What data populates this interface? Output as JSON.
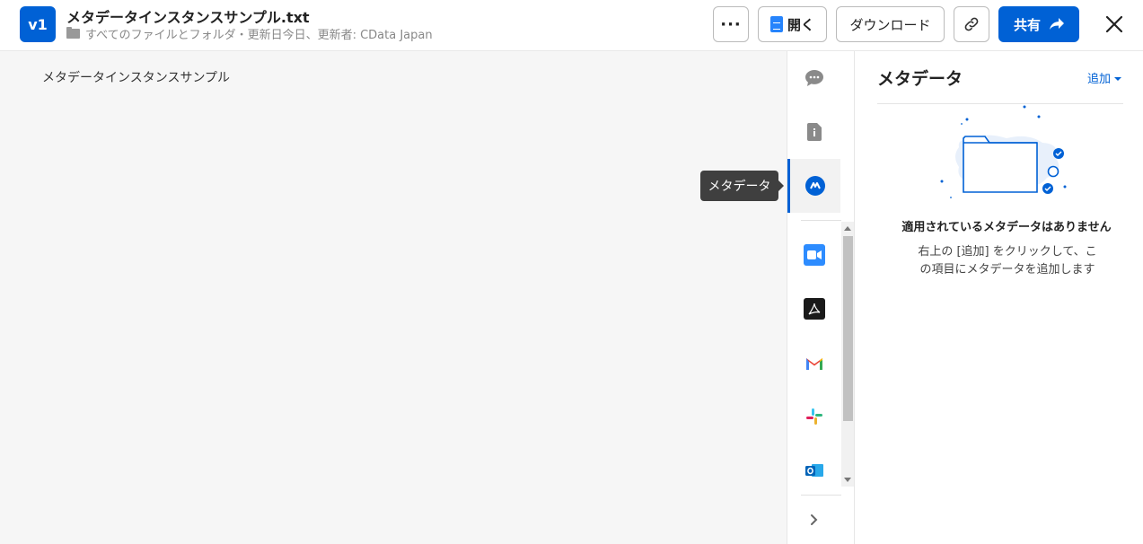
{
  "header": {
    "version": "v1",
    "file_title": "メタデータインスタンスサンプル.txt",
    "file_path": "すべてのファイルとフォルダ・更新日今日、更新者: CData Japan",
    "more_label": "···",
    "open_label": "開く",
    "download_label": "ダウンロード",
    "share_label": "共有"
  },
  "preview": {
    "content": "メタデータインスタンスサンプル"
  },
  "sidenav": {
    "tooltip": "メタデータ",
    "active": "metadata",
    "apps": [
      "zoom-icon",
      "adobe-acrobat-icon",
      "gmail-icon",
      "slack-icon",
      "outlook-icon"
    ]
  },
  "panel": {
    "title": "メタデータ",
    "add_label": "追加",
    "empty_title": "適用されているメタデータはありません",
    "empty_desc": "右上の [追加] をクリックして、この項目にメタデータを追加します"
  },
  "colors": {
    "accent": "#0061d5",
    "preview_bg": "#f6f6f6"
  }
}
